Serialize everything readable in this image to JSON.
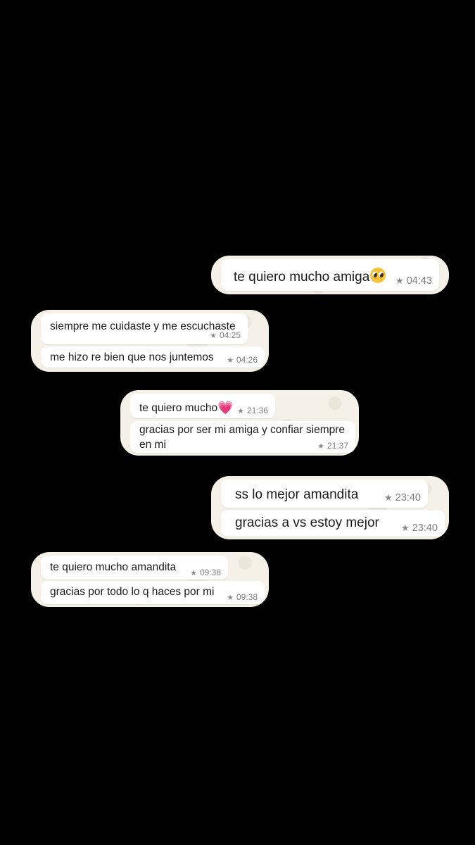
{
  "colors": {
    "background": "#000000",
    "cluster": "#f5f1e8",
    "bubble": "#ffffff",
    "text": "#1b1b1b",
    "meta": "#7d7d7d",
    "heart": "#f26c9e"
  },
  "icons": {
    "star": "★",
    "heart": "💗",
    "pleading_face": "pleading-face-icon"
  },
  "messages": [
    {
      "text": "te quiero mucho amiga",
      "time": "04:43",
      "direction": "outgoing",
      "starred": true,
      "emoji": "pleading-face"
    },
    {
      "text": "siempre me cuidaste y me escuchaste",
      "time": "04:25",
      "direction": "incoming",
      "starred": true
    },
    {
      "text": "me hizo re bien que nos juntemos",
      "time": "04:26",
      "direction": "incoming",
      "starred": true
    },
    {
      "text": "te quiero mucho",
      "time": "21:36",
      "direction": "incoming",
      "starred": true,
      "emoji": "growing-heart"
    },
    {
      "text": "gracias por ser mi amiga y confiar siempre\nen mi",
      "time": "21:37",
      "direction": "incoming",
      "starred": true
    },
    {
      "text": "ss lo mejor amandita",
      "time": "23:40",
      "direction": "outgoing",
      "starred": true
    },
    {
      "text": "gracias a vs estoy mejor",
      "time": "23:40",
      "direction": "outgoing",
      "starred": true
    },
    {
      "text": "te quiero mucho amandita",
      "time": "09:38",
      "direction": "incoming",
      "starred": true
    },
    {
      "text": "gracias por todo lo q haces por mi",
      "time": "09:38",
      "direction": "incoming",
      "starred": true
    }
  ]
}
